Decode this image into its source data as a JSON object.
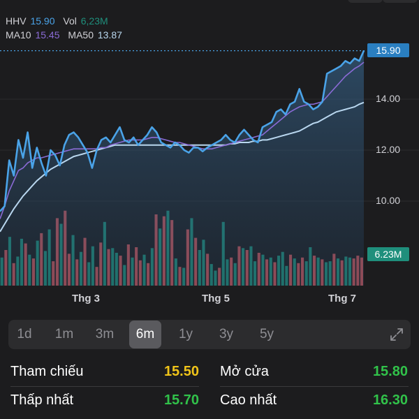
{
  "colors": {
    "price_line": "#4aa3e8",
    "ma10": "#8a6bd6",
    "ma50": "#b9d7ef",
    "volume_up": "#1f8f7c",
    "volume_down": "#c8545a",
    "value_yellow": "#f0c419",
    "value_green": "#31c24a",
    "value_blue": "#3f94d8"
  },
  "legend": {
    "ticker": "HHV",
    "price": "15.90",
    "vol_label": "Vol",
    "vol_value": "6,23M",
    "ma10_label": "MA10",
    "ma10_value": "15.45",
    "ma50_label": "MA50",
    "ma50_value": "13.87"
  },
  "price_tag": "15.90",
  "volume_tag": "6.23M",
  "chart_data": {
    "type": "line",
    "y_ticks": [
      "14.00",
      "12.00",
      "10.00"
    ],
    "x_ticks": [
      "Thg 3",
      "Thg 5",
      "Thg 7"
    ],
    "price": [
      9.6,
      9.8,
      11.6,
      11.0,
      12.4,
      11.7,
      12.7,
      11.3,
      12.1,
      11.5,
      11.0,
      12.0,
      11.8,
      11.4,
      12.2,
      12.6,
      12.7,
      12.5,
      12.2,
      11.9,
      11.3,
      12.0,
      12.4,
      12.5,
      12.3,
      12.6,
      12.9,
      12.4,
      12.3,
      12.5,
      12.2,
      12.4,
      12.6,
      12.9,
      12.7,
      12.3,
      12.2,
      12.1,
      12.3,
      12.2,
      12.0,
      11.9,
      12.1,
      12.1,
      11.95,
      12.1,
      12.2,
      12.3,
      12.4,
      12.6,
      12.4,
      12.3,
      12.6,
      12.8,
      12.6,
      12.4,
      12.3,
      12.9,
      13.0,
      13.1,
      13.5,
      13.6,
      13.4,
      13.8,
      13.9,
      14.4,
      13.9,
      13.8,
      13.6,
      13.7,
      13.9,
      15.0,
      15.1,
      15.2,
      15.3,
      15.5,
      15.4,
      15.6,
      15.5,
      15.9
    ],
    "ma10": [
      9.3,
      9.8,
      10.4,
      10.8,
      11.2,
      11.3,
      11.5,
      11.6,
      11.7,
      11.7,
      11.75,
      11.8,
      11.85,
      11.9,
      11.95,
      12.0,
      12.05,
      12.05,
      12.05,
      12.05,
      12.05,
      12.05,
      12.1,
      12.1,
      12.2,
      12.25,
      12.3,
      12.35,
      12.4,
      12.4,
      12.4,
      12.4,
      12.45,
      12.5,
      12.5,
      12.45,
      12.4,
      12.35,
      12.3,
      12.3,
      12.25,
      12.2,
      12.15,
      12.1,
      12.05,
      12.05,
      12.05,
      12.1,
      12.15,
      12.2,
      12.25,
      12.3,
      12.35,
      12.4,
      12.45,
      12.5,
      12.55,
      12.6,
      12.75,
      12.9,
      13.05,
      13.2,
      13.35,
      13.5,
      13.6,
      13.7,
      13.75,
      13.8,
      13.8,
      13.85,
      13.9,
      14.1,
      14.3,
      14.5,
      14.7,
      14.9,
      15.05,
      15.2,
      15.3,
      15.45
    ],
    "ma50": [
      8.8,
      9.1,
      9.4,
      9.7,
      9.95,
      10.2,
      10.4,
      10.6,
      10.8,
      10.95,
      11.1,
      11.25,
      11.35,
      11.45,
      11.55,
      11.65,
      11.75,
      11.8,
      11.85,
      11.9,
      11.95,
      12.0,
      12.05,
      12.1,
      12.15,
      12.2,
      12.2,
      12.2,
      12.2,
      12.2,
      12.2,
      12.2,
      12.2,
      12.2,
      12.2,
      12.2,
      12.2,
      12.2,
      12.2,
      12.2,
      12.2,
      12.2,
      12.2,
      12.2,
      12.2,
      12.2,
      12.2,
      12.2,
      12.2,
      12.2,
      12.25,
      12.25,
      12.3,
      12.3,
      12.3,
      12.35,
      12.35,
      12.4,
      12.4,
      12.45,
      12.5,
      12.55,
      12.6,
      12.65,
      12.7,
      12.75,
      12.85,
      12.95,
      13.05,
      13.1,
      13.2,
      13.3,
      13.4,
      13.5,
      13.55,
      13.6,
      13.65,
      13.7,
      13.8,
      13.87
    ],
    "volume_millions": [
      3.0,
      3.8,
      5.2,
      2.4,
      3.1,
      5.0,
      4.5,
      3.3,
      2.9,
      4.8,
      5.6,
      3.7,
      6.0,
      2.6,
      7.2,
      6.6,
      8.0,
      3.4,
      5.4,
      2.8,
      3.6,
      5.1,
      2.5,
      4.2,
      2.0,
      4.6,
      6.8,
      3.9,
      4.0,
      3.5,
      3.2,
      2.2,
      4.4,
      3.0,
      4.1,
      2.7,
      3.3,
      2.4,
      4.0,
      7.6,
      6.1,
      7.4,
      8.0,
      7.0,
      2.9,
      2.0,
      1.9,
      6.0,
      7.2,
      5.1,
      3.8,
      4.9,
      3.4,
      2.3,
      1.6,
      1.9,
      6.8,
      2.8,
      3.0,
      2.4,
      4.2,
      4.0,
      3.8,
      4.2,
      2.6,
      3.5,
      3.3,
      2.8,
      3.0,
      2.5,
      3.2,
      3.6,
      2.1,
      3.3,
      2.9,
      2.4,
      3.0,
      2.6,
      4.1,
      3.2,
      3.0,
      2.8,
      2.5,
      2.6,
      3.4,
      2.9,
      2.7,
      3.1,
      3.0,
      2.9,
      3.2,
      3.0
    ],
    "volume_up": [
      true,
      false,
      true,
      false,
      true,
      true,
      false,
      true,
      false,
      true,
      false,
      true,
      true,
      false,
      false,
      true,
      false,
      false,
      true,
      false,
      true,
      false,
      true,
      true,
      false,
      false,
      true,
      false,
      true,
      true,
      false,
      true,
      false,
      true,
      false,
      false,
      true,
      false,
      true,
      false,
      true,
      false,
      true,
      false,
      true,
      false,
      true,
      false,
      true,
      false,
      true,
      true,
      false,
      true,
      true,
      false,
      true,
      true,
      false,
      true,
      false,
      true,
      false,
      true,
      true,
      false,
      true,
      false,
      true,
      false,
      true,
      true,
      true,
      false,
      true,
      false,
      false,
      true,
      true,
      false,
      true,
      false,
      true,
      true,
      false,
      true,
      false,
      true,
      true,
      false
    ]
  },
  "axis_labels": {
    "t1": "14.00",
    "t2": "12.00",
    "t3": "10.00"
  },
  "x_labels": {
    "a": "Thg 3",
    "b": "Thg 5",
    "c": "Thg 7"
  },
  "ranges": [
    "1d",
    "1m",
    "3m",
    "6m",
    "1y",
    "3y",
    "5y"
  ],
  "active_range": "6m",
  "range_labels": {
    "r0": "1d",
    "r1": "1m",
    "r2": "3m",
    "r3": "6m",
    "r4": "1y",
    "r5": "3y",
    "r6": "5y"
  },
  "stats": {
    "reference_label": "Tham chiếu",
    "reference_value": "15.50",
    "open_label": "Mở cửa",
    "open_value": "15.80",
    "low_label": "Thấp nhất",
    "low_value": "15.70",
    "high_label": "Cao nhất",
    "high_value": "16.30"
  }
}
